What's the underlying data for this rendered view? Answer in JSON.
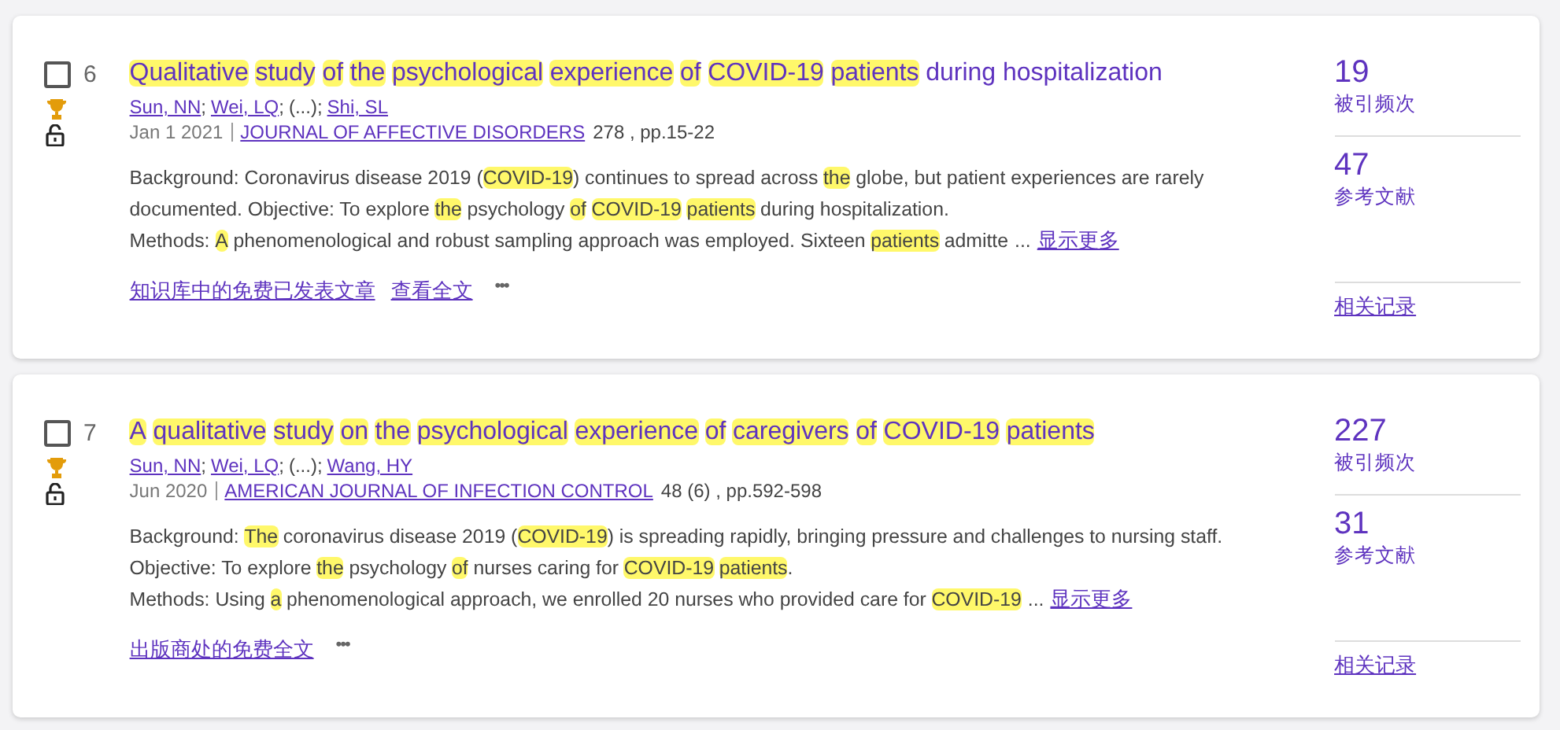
{
  "records": [
    {
      "number": "6",
      "checked": false,
      "award": true,
      "open_access": true,
      "title": [
        {
          "text": "Qualitative",
          "highlight": true
        },
        {
          "text": "study",
          "highlight": true
        },
        {
          "text": "of",
          "highlight": true
        },
        {
          "text": "the",
          "highlight": true
        },
        {
          "text": "psychological",
          "highlight": true
        },
        {
          "text": "experience",
          "highlight": true
        },
        {
          "text": "of",
          "highlight": true
        },
        {
          "text": "COVID-19",
          "highlight": true
        },
        {
          "text": "patients",
          "highlight": true
        },
        {
          "text": "during hospitalization",
          "highlight": false
        }
      ],
      "authors": [
        {
          "name": "Sun, NN",
          "link": true
        },
        {
          "name": "Wei, LQ",
          "link": true
        },
        {
          "name": "(...)",
          "link": false
        },
        {
          "name": "Shi, SL",
          "link": true
        }
      ],
      "author_separator": ";",
      "date": "Jan 1 2021",
      "journal": "JOURNAL OF AFFECTIVE DISORDERS",
      "volume": "278 , pp.15-22",
      "abstract": [
        [
          {
            "text": "Background: Coronavirus disease 2019 (",
            "highlight": false
          },
          {
            "text": "COVID-19",
            "highlight": true
          },
          {
            "text": ") continues to spread across",
            "highlight": false
          },
          {
            "text": "the",
            "highlight": true
          },
          {
            "text": "globe, but patient experiences are rarely",
            "highlight": false
          }
        ],
        [
          {
            "text": "documented. Objective: To explore",
            "highlight": false
          },
          {
            "text": "the",
            "highlight": true
          },
          {
            "text": "psychology",
            "highlight": false
          },
          {
            "text": "of",
            "highlight": true
          },
          {
            "text": "COVID-19",
            "highlight": true
          },
          {
            "text": "patients",
            "highlight": true
          },
          {
            "text": "during hospitalization.",
            "highlight": false
          }
        ],
        [
          {
            "text": "Methods:",
            "highlight": false
          },
          {
            "text": "A",
            "highlight": true
          },
          {
            "text": "phenomenological and robust sampling approach was employed. Sixteen",
            "highlight": false
          },
          {
            "text": "patients",
            "highlight": true
          },
          {
            "text": "admitte",
            "highlight": false
          }
        ]
      ],
      "ellipsis": "...",
      "show_more": "显示更多",
      "links": [
        "知识库中的免费已发表文章",
        "查看全文"
      ],
      "more": "•••",
      "times_cited": "19",
      "times_cited_label": "被引频次",
      "references": "47",
      "references_label": "参考文献",
      "related": "相关记录"
    },
    {
      "number": "7",
      "checked": false,
      "award": true,
      "open_access": true,
      "title": [
        {
          "text": "A",
          "highlight": true
        },
        {
          "text": "qualitative",
          "highlight": true
        },
        {
          "text": "study",
          "highlight": true
        },
        {
          "text": "on",
          "highlight": true
        },
        {
          "text": "the",
          "highlight": true
        },
        {
          "text": "psychological",
          "highlight": true
        },
        {
          "text": "experience",
          "highlight": true
        },
        {
          "text": "of",
          "highlight": true
        },
        {
          "text": "caregivers",
          "highlight": true
        },
        {
          "text": "of",
          "highlight": true
        },
        {
          "text": "COVID-19",
          "highlight": true
        },
        {
          "text": "patients",
          "highlight": true
        }
      ],
      "authors": [
        {
          "name": "Sun, NN",
          "link": true
        },
        {
          "name": "Wei, LQ",
          "link": true
        },
        {
          "name": "(...)",
          "link": false
        },
        {
          "name": "Wang, HY",
          "link": true
        }
      ],
      "author_separator": ";",
      "date": "Jun 2020",
      "journal": "AMERICAN JOURNAL OF INFECTION CONTROL",
      "volume": "48 (6) , pp.592-598",
      "abstract": [
        [
          {
            "text": "Background:",
            "highlight": false
          },
          {
            "text": "The",
            "highlight": true
          },
          {
            "text": "coronavirus disease 2019 (",
            "highlight": false
          },
          {
            "text": "COVID-19",
            "highlight": true
          },
          {
            "text": ") is spreading rapidly, bringing pressure and challenges to nursing staff.",
            "highlight": false
          }
        ],
        [
          {
            "text": "Objective: To explore",
            "highlight": false
          },
          {
            "text": "the",
            "highlight": true
          },
          {
            "text": "psychology",
            "highlight": false
          },
          {
            "text": "of",
            "highlight": true
          },
          {
            "text": "nurses caring for",
            "highlight": false
          },
          {
            "text": "COVID-19",
            "highlight": true
          },
          {
            "text": "patients",
            "highlight": true
          },
          {
            "text": ".",
            "highlight": false
          }
        ],
        [
          {
            "text": "Methods: Using",
            "highlight": false
          },
          {
            "text": "a",
            "highlight": true
          },
          {
            "text": "phenomenological approach, we enrolled 20 nurses who provided care for",
            "highlight": false
          },
          {
            "text": "COVID-19",
            "highlight": true
          }
        ]
      ],
      "ellipsis": "...",
      "show_more": "显示更多",
      "links": [
        "出版商处的免费全文"
      ],
      "more": "•••",
      "times_cited": "227",
      "times_cited_label": "被引频次",
      "references": "31",
      "references_label": "参考文献",
      "related": "相关记录"
    }
  ]
}
